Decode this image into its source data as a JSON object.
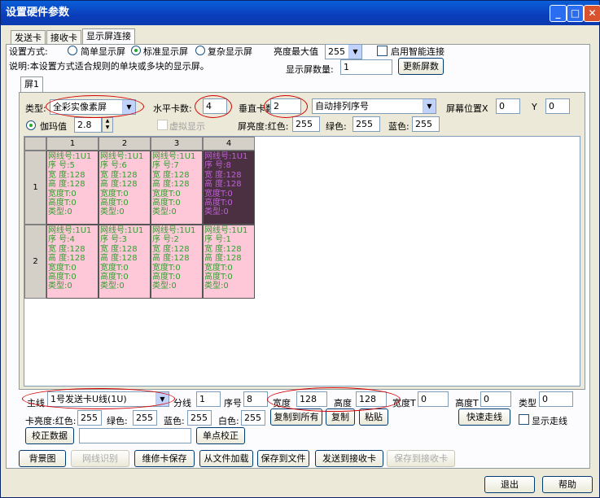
{
  "window": {
    "title": "设置硬件参数"
  },
  "tabs": [
    "发送卡",
    "接收卡",
    "显示屏连接"
  ],
  "setting_mode": {
    "label": "设置方式:",
    "options": [
      "简单显示屏",
      "标准显示屏",
      "复杂显示屏"
    ],
    "selected": "标准显示屏"
  },
  "brightness_max": {
    "label": "亮度最大值",
    "value": "255"
  },
  "smart_connect": {
    "label": "启用智能连接"
  },
  "description": "说明:本设置方式适合规则的单块或多块的显示屏。",
  "screen_count": {
    "label": "显示屏数量:",
    "value": "1"
  },
  "update_button": "更新屏数",
  "screen_tab": "屏1",
  "screen": {
    "type_label": "类型:",
    "type_value": "全彩实像素屏",
    "hcard_label": "水平卡数:",
    "hcard_value": "4",
    "vcard_label": "垂直卡数:",
    "vcard_value": "2",
    "auto_order": "自动排列序号",
    "pos_label": "屏幕位置X",
    "pos_x": "0",
    "pos_y_label": "Y",
    "pos_y": "0",
    "gamma_label": "伽玛值",
    "gamma_value": "2.8",
    "virtual_label": "虚拟显示",
    "bright_label": "屏亮度:红色:",
    "bright_red": "255",
    "green_label": "绿色:",
    "bright_green": "255",
    "blue_label": "蓝色:",
    "bright_blue": "255"
  },
  "grid": {
    "columns": [
      "1",
      "2",
      "3",
      "4"
    ],
    "rows": [
      "1",
      "2"
    ],
    "cells": [
      [
        [
          "网线号:1U1",
          "序 号:5",
          "宽 度:128",
          "高 度:128",
          "宽度T:0",
          "高度T:0",
          "类型:0"
        ],
        [
          "网线号:1U1",
          "序 号:6",
          "宽 度:128",
          "高 度:128",
          "宽度T:0",
          "高度T:0",
          "类型:0"
        ],
        [
          "网线号:1U1",
          "序 号:7",
          "宽 度:128",
          "高 度:128",
          "宽度T:0",
          "高度T:0",
          "类型:0"
        ],
        [
          "网线号:1U1",
          "序 号:8",
          "宽 度:128",
          "高 度:128",
          "宽度T:0",
          "高度T:0",
          "类型:0"
        ]
      ],
      [
        [
          "网线号:1U1",
          "序 号:4",
          "宽 度:128",
          "高 度:128",
          "宽度T:0",
          "高度T:0",
          "类型:0"
        ],
        [
          "网线号:1U1",
          "序 号:3",
          "宽 度:128",
          "高 度:128",
          "宽度T:0",
          "高度T:0",
          "类型:0"
        ],
        [
          "网线号:1U1",
          "序 号:2",
          "宽 度:128",
          "高 度:128",
          "宽度T:0",
          "高度T:0",
          "类型:0"
        ],
        [
          "网线号:1U1",
          "序 号:1",
          "宽 度:128",
          "高 度:128",
          "宽度T:0",
          "高度T:0",
          "类型:0"
        ]
      ]
    ]
  },
  "cell_edit": {
    "main_label": "主线",
    "main_value": "1号发送卡U线(1U)",
    "branch_label": "分线",
    "branch_value": "1",
    "seq_label": "序号",
    "seq_value": "8",
    "width_label": "宽度",
    "width_value": "128",
    "height_label": "高度",
    "height_value": "128",
    "widthT_label": "宽度T",
    "widthT_value": "0",
    "heightT_label": "高度T",
    "heightT_value": "0",
    "type_label": "类型",
    "type_value": "0",
    "card_bright_label": "卡亮度:红色:",
    "card_red": "255",
    "card_green_label": "绿色:",
    "card_green": "255",
    "card_blue_label": "蓝色:",
    "card_blue": "255",
    "card_white_label": "白色:",
    "card_white": "255",
    "copy_all": "复制到所有",
    "copy": "复制",
    "paste": "粘贴",
    "fast_route": "快速走线",
    "show_route": "显示走线",
    "correct_data": "校正数据",
    "correct_value": "",
    "point_correct": "单点校正"
  },
  "bottom_buttons": [
    "背景图",
    "网线识别",
    "维修卡保存",
    "从文件加载",
    "保存到文件",
    "发送到接收卡",
    "保存到接收卡"
  ],
  "footer": {
    "exit": "退出",
    "help": "帮助"
  },
  "colors": {
    "title_bar": "#0b3dbb",
    "cell_bg": "#ffc8d8",
    "cell_text": "#2fa02f",
    "cell_selected_bg": "#4a3040",
    "annotation": "#d40000"
  }
}
